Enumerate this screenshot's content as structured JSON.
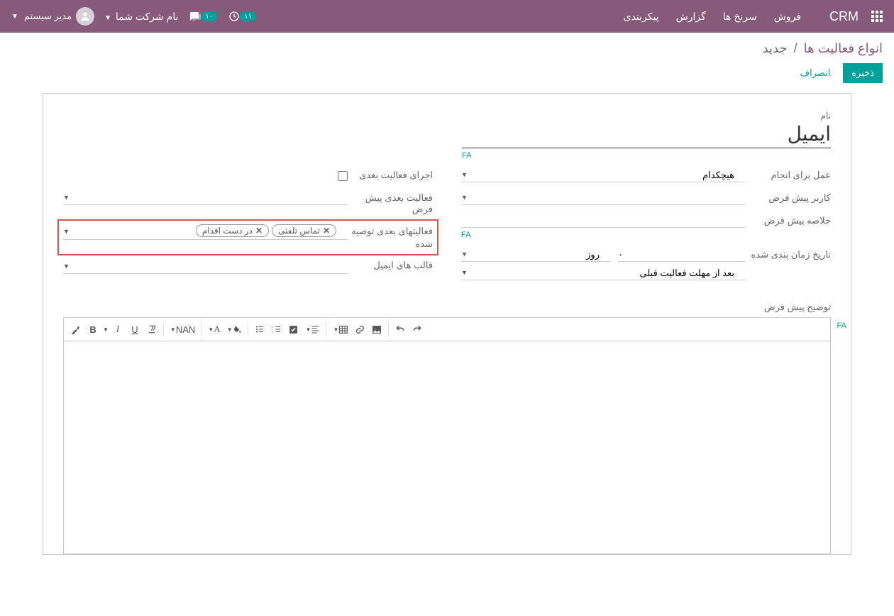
{
  "nav": {
    "brand": "CRM",
    "menus": [
      "فروش",
      "سرنخ ها",
      "گزارش",
      "پیکربندی"
    ],
    "badge_msg_count": "۱۰",
    "badge_clock_count": "۱۱",
    "company": "نام شرکت شما",
    "user": "مدیر سیستم"
  },
  "breadcrumb": {
    "parent": "انواع فعالیت ها",
    "current": "جدید"
  },
  "buttons": {
    "save": "ذخیره",
    "discard": "انصراف"
  },
  "lang_badge": "FA",
  "fields": {
    "name_label": "نام",
    "name_value": "ایمیل",
    "action_label": "عمل برای انجام",
    "action_value": "هیچکدام",
    "default_user_label": "کاربر پیش فرض",
    "default_summary_label": "خلاصه پیش فرض",
    "force_next_label": "اجرای فعالیت بعدی",
    "default_next_label": "فعالیت بعدی پیش فرض",
    "recommended_next_label": "فعالیتهای بعدی توصیه شده",
    "recommended_tags": [
      "تماس تلفنی",
      "در دست اقدام"
    ],
    "mail_templates_label": "قالب های ایمیل",
    "scheduled_label": "تاریخ زمان بندی شده",
    "scheduled_count": "۰",
    "scheduled_unit": "روز",
    "scheduled_from": "بعد از مهلت فعالیت قبلی",
    "default_desc_label": "توضیح پیش فرض",
    "nan": "NAN"
  }
}
